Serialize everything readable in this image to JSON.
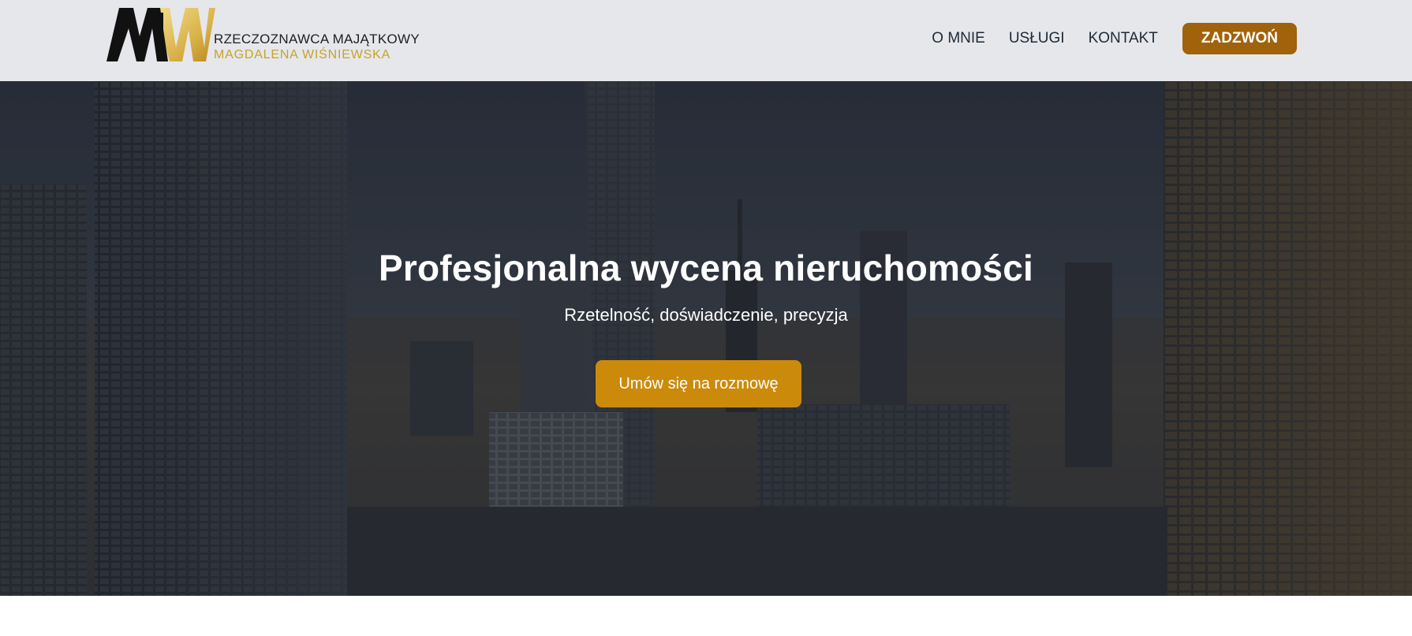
{
  "brand": {
    "line1": "RZECZOZNAWCA MAJĄTKOWY",
    "line2": "MAGDALENA WIŚNIEWSKA",
    "monogram": "MW",
    "colors": {
      "dark": "#111111",
      "gold": "#e0bd52"
    }
  },
  "nav": {
    "items": [
      {
        "label": "O MNIE"
      },
      {
        "label": "USŁUGI"
      },
      {
        "label": "KONTAKT"
      }
    ],
    "call_label": "ZADZWOŃ"
  },
  "hero": {
    "title": "Profesjonalna wycena nieruchomości",
    "subtitle": "Rzetelność, doświadczenie, precyzja",
    "cta_label": "Umów się na rozmowę",
    "background_image": "city-skyline-skyscrapers"
  },
  "colors": {
    "header_bg": "#e5e7eb",
    "call_button": "#a0620b",
    "cta_button": "#cc8a0b",
    "hero_overlay": "#1f2530"
  }
}
